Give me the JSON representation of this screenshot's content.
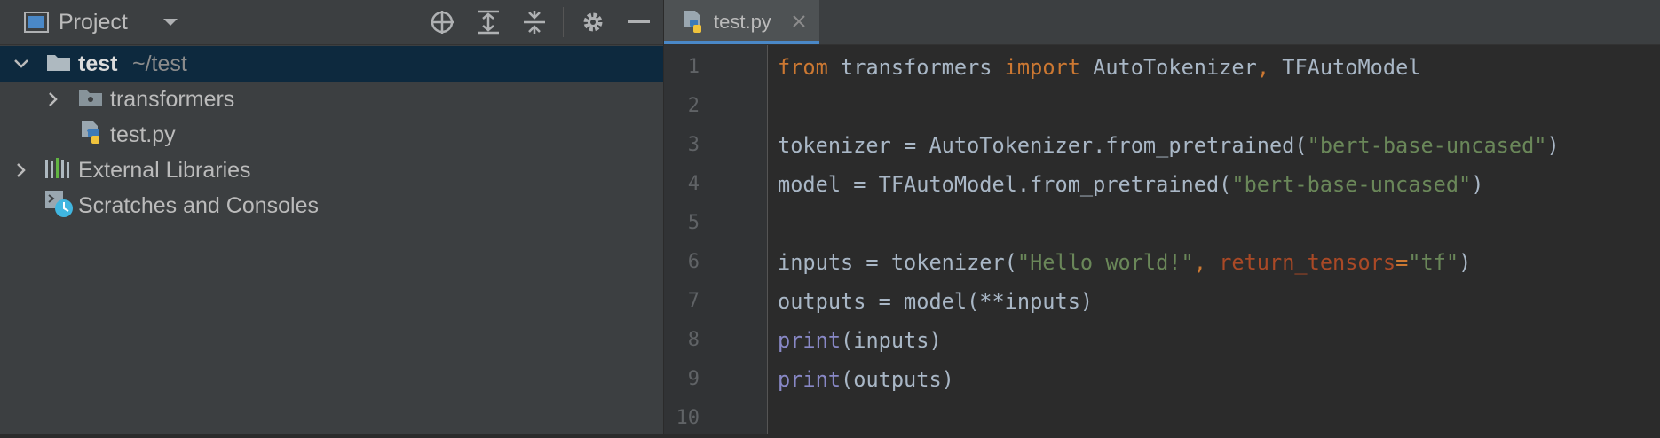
{
  "project_panel": {
    "title": "Project",
    "tree": [
      {
        "name": "test",
        "hint": "~/test"
      },
      {
        "name": "transformers"
      },
      {
        "name": "test.py"
      },
      {
        "name": "External Libraries"
      },
      {
        "name": "Scratches and Consoles"
      }
    ]
  },
  "editor": {
    "tab": {
      "label": "test.py"
    },
    "line_numbers": [
      "1",
      "2",
      "3",
      "4",
      "5",
      "6",
      "7",
      "8",
      "9",
      "10"
    ],
    "code": {
      "l1": {
        "t1": "from",
        "t2": " transformers ",
        "t3": "import",
        "t4": " AutoTokenizer",
        "t5": ",",
        "t6": " TFAutoModel"
      },
      "l3": {
        "t1": "tokenizer = AutoTokenizer.from_pretrained(",
        "t2": "\"bert-base-uncased\"",
        "t3": ")"
      },
      "l4": {
        "t1": "model = TFAutoModel.from_pretrained(",
        "t2": "\"bert-base-uncased\"",
        "t3": ")"
      },
      "l6": {
        "t1": "inputs = tokenizer(",
        "t2": "\"Hello world!\"",
        "t3": ", ",
        "t4": "return_tensors",
        "t5": "=",
        "t6": "\"tf\"",
        "t7": ")"
      },
      "l7": {
        "t1": "outputs = model(**inputs)"
      },
      "l8": {
        "t1": "print",
        "t2": "(inputs)"
      },
      "l9": {
        "t1": "print",
        "t2": "(outputs)"
      }
    }
  },
  "colors": {
    "keyword": "#cc7832",
    "string": "#6a8759",
    "parameter": "#aa4926",
    "builtin": "#8888c6",
    "selection": "#0d293e",
    "tab_underline": "#4a88c7"
  }
}
